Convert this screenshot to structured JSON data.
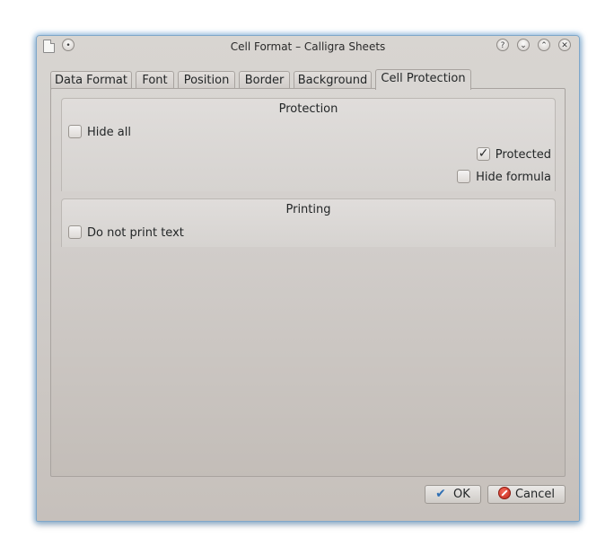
{
  "window": {
    "title": "Cell Format – Calligra Sheets",
    "titlebar_buttons": [
      "help",
      "minimize",
      "maximize",
      "close"
    ]
  },
  "tabs": [
    {
      "label": "Data Format",
      "active": false
    },
    {
      "label": "Font",
      "active": false
    },
    {
      "label": "Position",
      "active": false
    },
    {
      "label": "Border",
      "active": false
    },
    {
      "label": "Background",
      "active": false
    },
    {
      "label": "Cell Protection",
      "active": true
    }
  ],
  "protection": {
    "title": "Protection",
    "hide_all": {
      "label": "Hide all",
      "checked": false
    },
    "protected": {
      "label": "Protected",
      "checked": true
    },
    "hide_formula": {
      "label": "Hide formula",
      "checked": false
    }
  },
  "printing": {
    "title": "Printing",
    "do_not_print": {
      "label": "Do not print text",
      "checked": false
    }
  },
  "buttons": {
    "ok": "OK",
    "cancel": "Cancel"
  },
  "colors": {
    "window_glow": "#5096d2",
    "ok_icon": "#2f6fb3",
    "cancel_icon": "#c0261a"
  }
}
